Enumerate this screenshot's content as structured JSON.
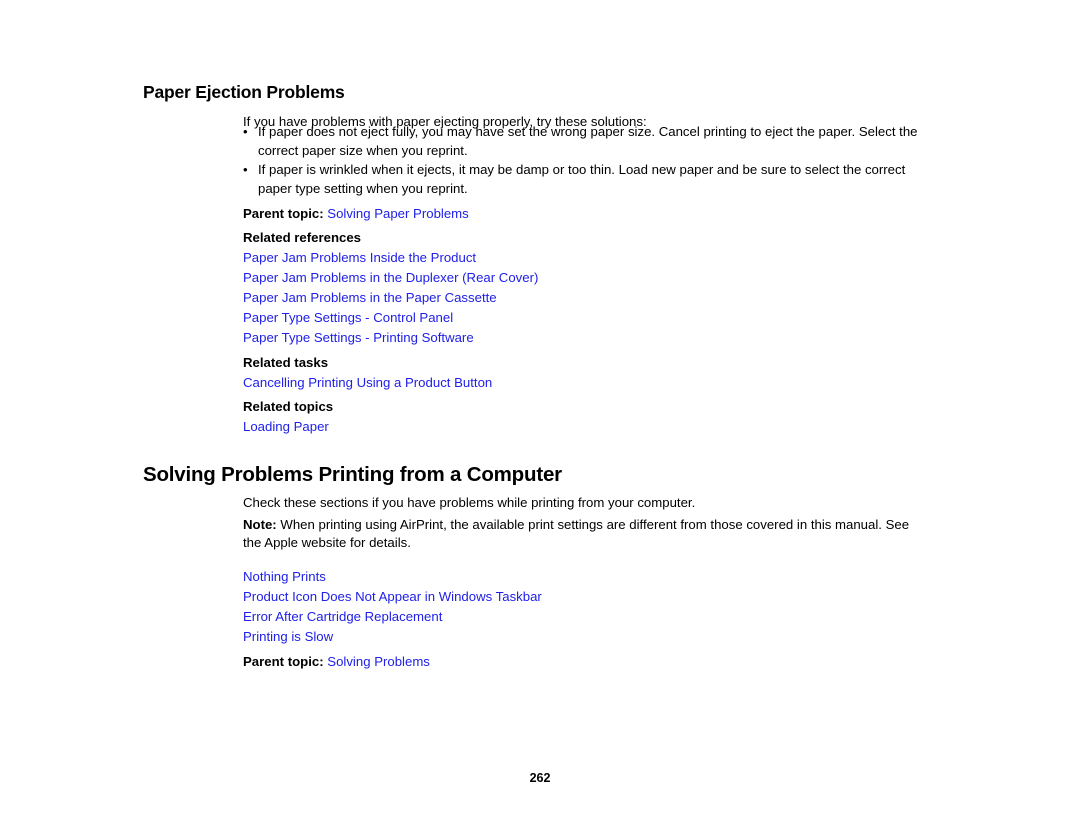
{
  "document": {
    "page_number": "262",
    "link_color": "#2020e8",
    "text_color": "#000000",
    "background_color": "#ffffff"
  },
  "section_1": {
    "heading": "Paper Ejection Problems",
    "intro": "If you have problems with paper ejecting properly, try these solutions:",
    "bullet_marker": "•",
    "bullets": [
      "If paper does not eject fully, you may have set the wrong paper size. Cancel printing to eject the paper. Select the correct paper size when you reprint.",
      "If paper is wrinkled when it ejects, it may be damp or too thin. Load new paper and be sure to select the correct paper type setting when you reprint."
    ],
    "parent_topic_label": "Parent topic:",
    "parent_topic_link": "Solving Paper Problems",
    "related_references_label": "Related references",
    "related_references": [
      "Paper Jam Problems Inside the Product",
      "Paper Jam Problems in the Duplexer (Rear Cover)",
      "Paper Jam Problems in the Paper Cassette",
      "Paper Type Settings - Control Panel",
      "Paper Type Settings - Printing Software"
    ],
    "related_tasks_label": "Related tasks",
    "related_tasks": [
      "Cancelling Printing Using a Product Button"
    ],
    "related_topics_label": "Related topics",
    "related_topics": [
      "Loading Paper"
    ]
  },
  "section_2": {
    "heading": "Solving Problems Printing from a Computer",
    "intro": "Check these sections if you have problems while printing from your computer.",
    "note_label": "Note:",
    "note_text": " When printing using AirPrint, the available print settings are different from those covered in this manual. See the Apple website for details.",
    "subtopics": [
      "Nothing Prints",
      "Product Icon Does Not Appear in Windows Taskbar",
      "Error After Cartridge Replacement",
      "Printing is Slow"
    ],
    "parent_topic_label": "Parent topic:",
    "parent_topic_link": "Solving Problems"
  }
}
